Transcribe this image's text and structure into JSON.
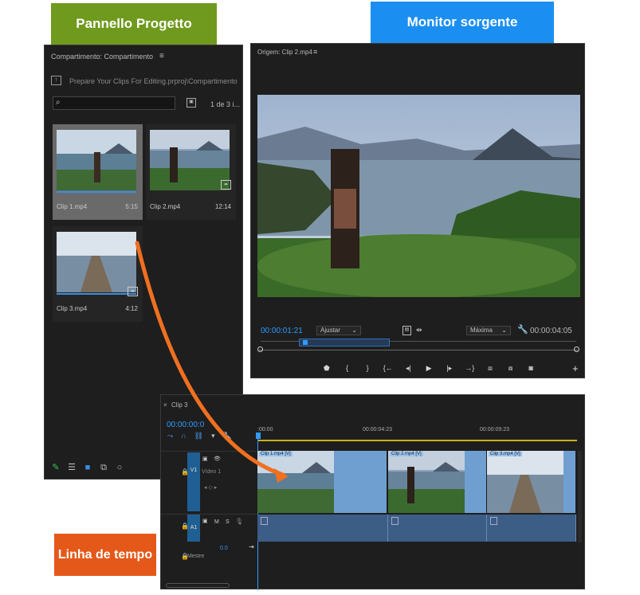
{
  "callouts": {
    "project": "Pannello Progetto",
    "monitor": "Monitor sorgente",
    "timeline": "Linha de tempo"
  },
  "colors": {
    "green": "#6f9a1e",
    "blue": "#1b8ef1",
    "orange": "#e4591a",
    "accent": "#2f9bff",
    "clip_video": "#6f9fd1",
    "clip_audio": "#3c5d86"
  },
  "project": {
    "title": "Compartimento: Compartimento",
    "menu_icon": "hamburger-icon",
    "path": "Prepare Your Clips For Editing.prproj\\Compartimento",
    "search_placeholder": "",
    "count": "1 de 3 i...",
    "clips": [
      {
        "name": "Clip 1.mp4",
        "duration": "5:15"
      },
      {
        "name": "Clip 2.mp4",
        "duration": "12:14"
      },
      {
        "name": "Clip 3.mp4",
        "duration": "4:12"
      }
    ],
    "bottom_icons": [
      "pencil-icon",
      "list-view-icon",
      "icon-view-icon",
      "freeform-view-icon",
      "zoom-slider-icon"
    ]
  },
  "monitor": {
    "title": "Origem: Clip 2.mp4",
    "timecode_current": "00:00:01:21",
    "fit": "Ajustar",
    "quality": "Máxima",
    "timecode_duration": "00:00:04:05",
    "controls": [
      "add-marker-icon",
      "mark-in-icon",
      "mark-out-icon",
      "go-to-in-icon",
      "step-back-icon",
      "play-icon",
      "step-forward-icon",
      "go-to-out-icon",
      "insert-icon",
      "overwrite-icon",
      "export-frame-icon",
      "camera-icon"
    ]
  },
  "timeline": {
    "title": "Clip 3",
    "timecode": "00:00:00:0",
    "ruler": [
      ":00:00",
      "00:00:04:23",
      "00:00:09:23"
    ],
    "video_track": {
      "id": "V1",
      "name": "Vídeo 1"
    },
    "audio_track": {
      "id": "A1",
      "mute": "M",
      "solo": "S"
    },
    "master": {
      "name": "Mestre",
      "value": "0.0"
    },
    "clips": [
      "Clip 1.mp4 [V]",
      "Clip 2.mp4 [V]",
      "Clip 3.mp4 [V]"
    ]
  }
}
